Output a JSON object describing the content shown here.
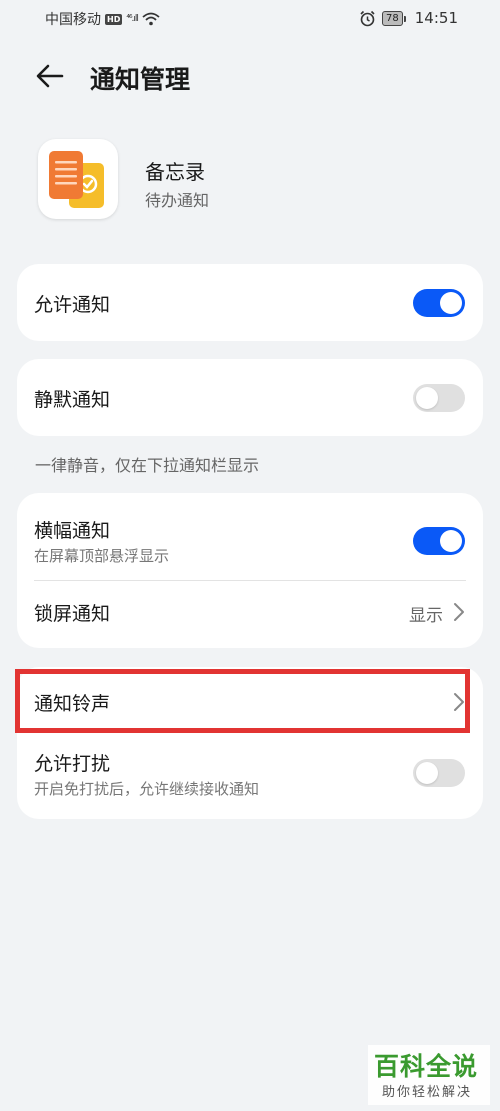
{
  "status_bar": {
    "carrier": "中国移动",
    "hd": "HD",
    "signal": "⁴⁶.ıll",
    "battery": "78",
    "time": "14:51"
  },
  "header": {
    "title": "通知管理"
  },
  "app": {
    "name": "备忘录",
    "subtitle": "待办通知"
  },
  "settings": {
    "allow_notifications": {
      "label": "允许通知",
      "enabled": true
    },
    "silent_notifications": {
      "label": "静默通知",
      "enabled": false
    },
    "silent_hint": "一律静音，仅在下拉通知栏显示",
    "banner_notifications": {
      "label": "横幅通知",
      "subtitle": "在屏幕顶部悬浮显示",
      "enabled": true
    },
    "lock_screen_notifications": {
      "label": "锁屏通知",
      "value": "显示"
    },
    "notification_ringtone": {
      "label": "通知铃声"
    },
    "allow_disturb": {
      "label": "允许打扰",
      "subtitle": "开启免打扰后，允许继续接收通知",
      "enabled": false
    }
  },
  "watermark": {
    "title": "百科全说",
    "subtitle": "助你轻松解决"
  },
  "colors": {
    "accent": "#0a59f7",
    "highlight": "#e23432",
    "background": "#f1f3f5"
  }
}
